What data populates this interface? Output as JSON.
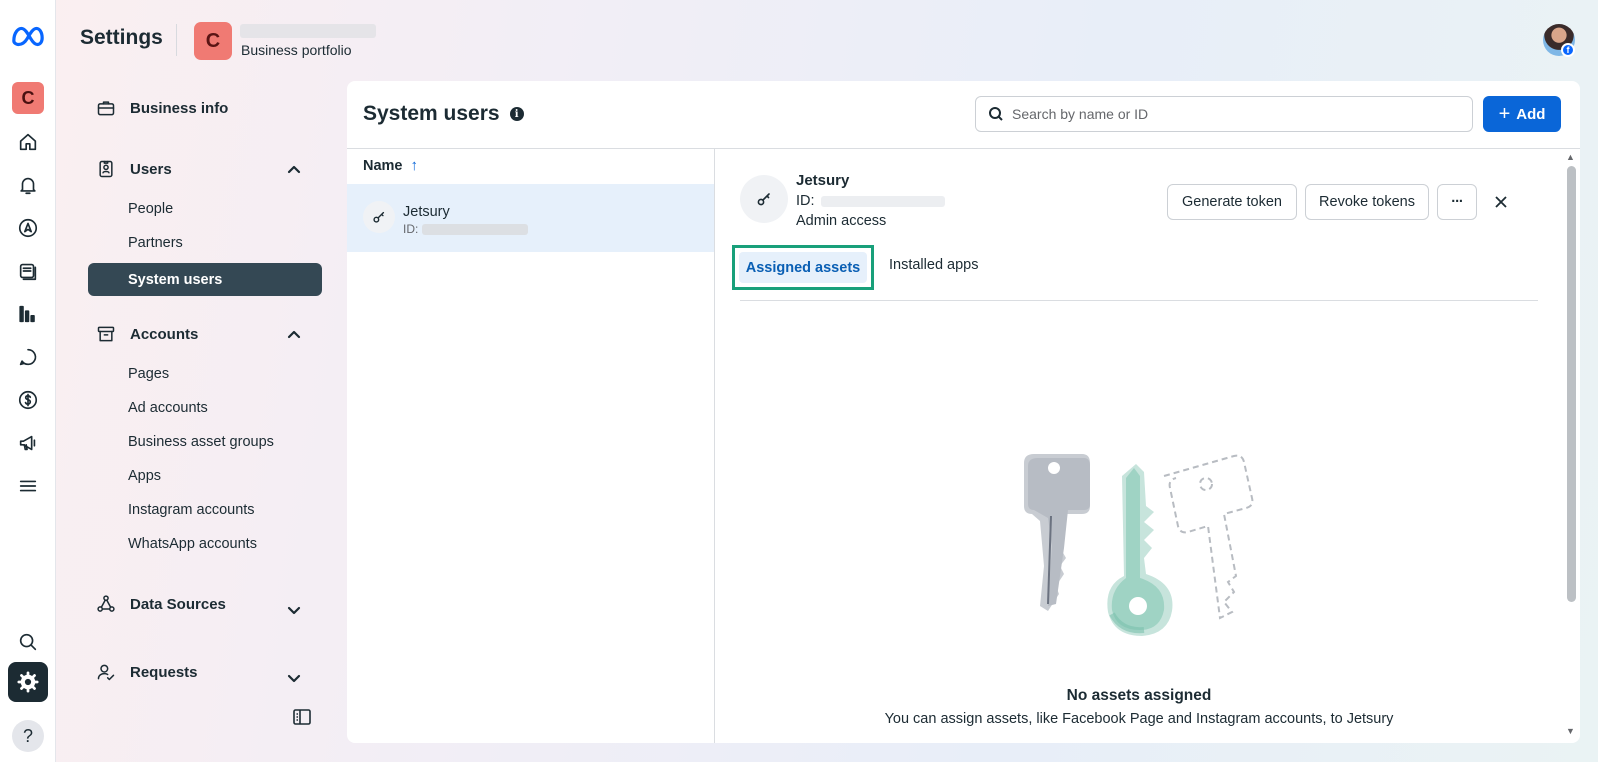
{
  "header": {
    "title": "Settings",
    "business_initial": "C",
    "business_subtitle": "Business portfolio"
  },
  "rail": {
    "business_initial": "C",
    "help": "?"
  },
  "sidebar": {
    "business_info": "Business info",
    "users": {
      "label": "Users",
      "items": [
        "People",
        "Partners",
        "System users"
      ],
      "active": "System users"
    },
    "accounts": {
      "label": "Accounts",
      "items": [
        "Pages",
        "Ad accounts",
        "Business asset groups",
        "Apps",
        "Instagram accounts",
        "WhatsApp accounts"
      ]
    },
    "data_sources": "Data Sources",
    "requests": "Requests"
  },
  "main": {
    "title": "System users",
    "info": "i",
    "search_placeholder": "Search by name or ID",
    "add_label": "Add",
    "list": {
      "column_header": "Name",
      "sort_arrow": "↑",
      "rows": [
        {
          "name": "Jetsury",
          "id_label": "ID:"
        }
      ]
    },
    "detail": {
      "name": "Jetsury",
      "id_label": "ID:",
      "access": "Admin access",
      "generate_token": "Generate token",
      "revoke_tokens": "Revoke tokens",
      "more": "···",
      "tabs": [
        "Assigned assets",
        "Installed apps"
      ],
      "active_tab": "Assigned assets",
      "empty_title": "No assets assigned",
      "empty_desc": "You can assign assets, like Facebook Page and Instagram accounts, to Jetsury"
    }
  },
  "colors": {
    "primary": "#0a66d8",
    "active_nav": "#344854",
    "tab_highlight": "#18a07a",
    "business_badge": "#f07a73"
  }
}
